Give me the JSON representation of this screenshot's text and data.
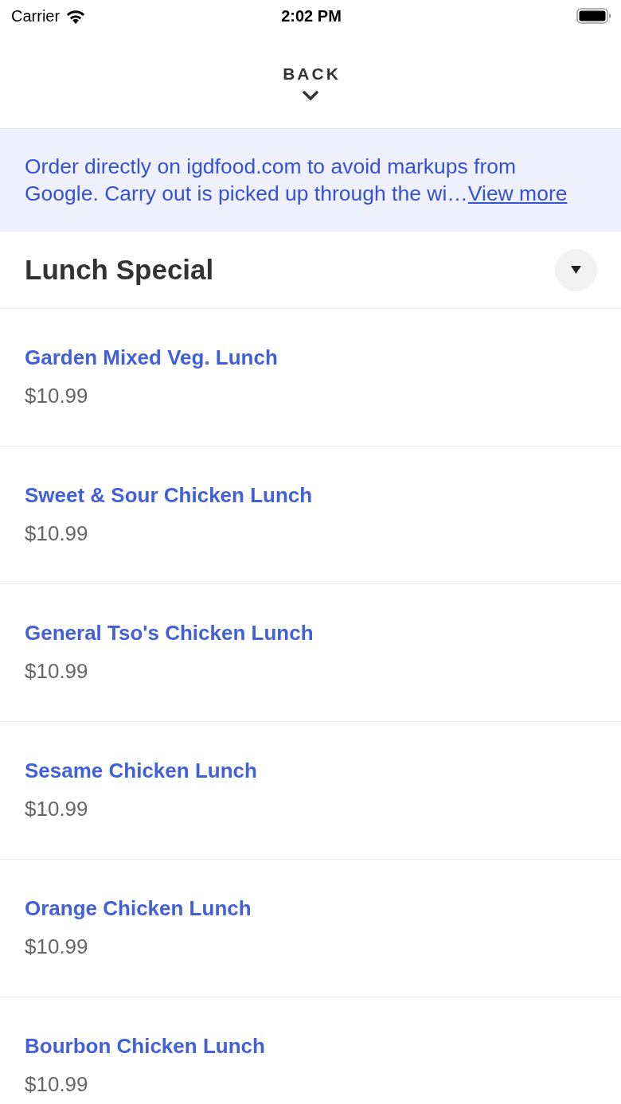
{
  "status_bar": {
    "carrier": "Carrier",
    "time": "2:02 PM"
  },
  "header": {
    "back_label": "BACK"
  },
  "banner": {
    "text": "Order directly on igdfood.com to avoid markups from Google. Carry out is picked up through the wi…",
    "link": "View more"
  },
  "section": {
    "title": "Lunch Special"
  },
  "items": [
    {
      "name": "Garden Mixed Veg. Lunch",
      "price": "$10.99"
    },
    {
      "name": "Sweet & Sour Chicken Lunch",
      "price": "$10.99"
    },
    {
      "name": "General Tso's Chicken Lunch",
      "price": "$10.99"
    },
    {
      "name": "Sesame Chicken Lunch",
      "price": "$10.99"
    },
    {
      "name": "Orange Chicken Lunch",
      "price": "$10.99"
    },
    {
      "name": "Bourbon Chicken Lunch",
      "price": "$10.99"
    }
  ]
}
